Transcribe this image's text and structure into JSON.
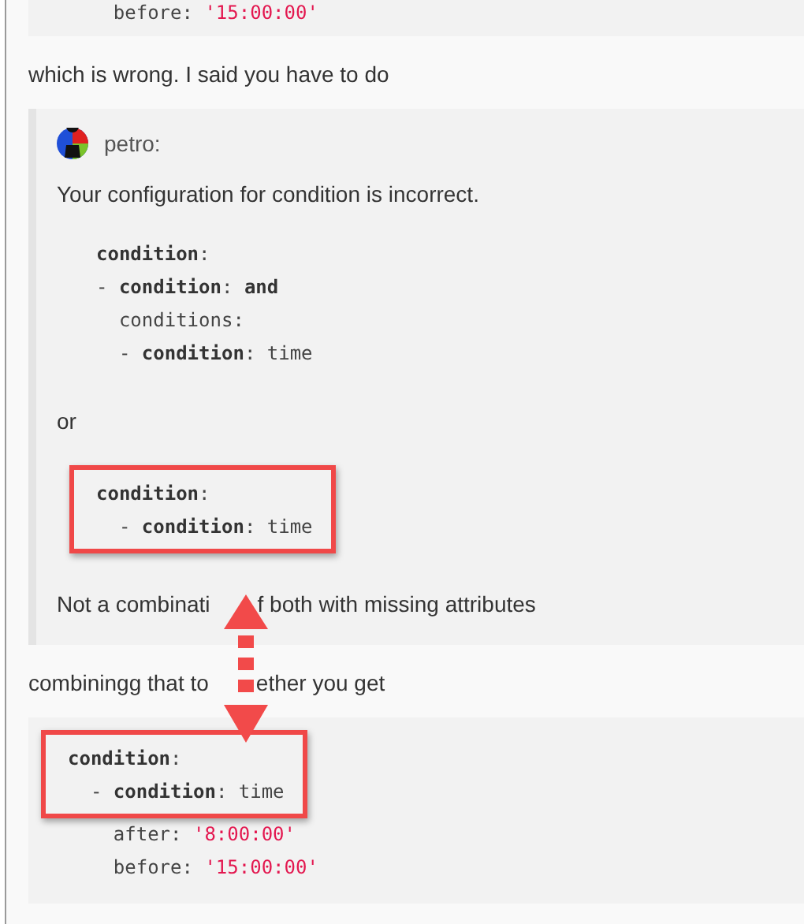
{
  "blocks": [
    {
      "kind": "code",
      "lines": [
        {
          "highlighted": false,
          "tokens": [
            {
              "kind": "plain",
              "text": "    before: "
            },
            {
              "kind": "string",
              "text": "'15:00:00'"
            }
          ]
        }
      ]
    },
    {
      "kind": "paragraph",
      "text": "which is wrong. I said you have to do"
    },
    {
      "kind": "quote",
      "author": "petro:",
      "blocks": [
        {
          "kind": "paragraph",
          "text": "Your configuration for condition is incorrect."
        },
        {
          "kind": "code",
          "lines": [
            {
              "highlighted": false,
              "tokens": [
                {
                  "kind": "key",
                  "text": "condition"
                },
                {
                  "kind": "plain",
                  "text": ":"
                }
              ]
            },
            {
              "highlighted": false,
              "tokens": [
                {
                  "kind": "plain",
                  "text": "- "
                },
                {
                  "kind": "key",
                  "text": "condition"
                },
                {
                  "kind": "plain",
                  "text": ": "
                },
                {
                  "kind": "key",
                  "text": "and"
                }
              ]
            },
            {
              "highlighted": false,
              "tokens": [
                {
                  "kind": "plain",
                  "text": "  conditions:"
                }
              ]
            },
            {
              "highlighted": false,
              "tokens": [
                {
                  "kind": "plain",
                  "text": "  - "
                },
                {
                  "kind": "key",
                  "text": "condition"
                },
                {
                  "kind": "plain",
                  "text": ": time"
                }
              ]
            }
          ]
        },
        {
          "kind": "paragraph",
          "text": "or"
        },
        {
          "kind": "code",
          "lines": [
            {
              "highlighted": true,
              "tokens": [
                {
                  "kind": "key",
                  "text": "condition"
                },
                {
                  "kind": "plain",
                  "text": ":"
                }
              ]
            },
            {
              "highlighted": true,
              "tokens": [
                {
                  "kind": "plain",
                  "text": "  - "
                },
                {
                  "kind": "key",
                  "text": "condition"
                },
                {
                  "kind": "plain",
                  "text": ": time"
                }
              ]
            }
          ]
        },
        {
          "kind": "paragraph",
          "parts": [
            "Not a combinati",
            "f both with missing attributes"
          ]
        }
      ]
    },
    {
      "kind": "paragraph",
      "parts": [
        "combiningg that to",
        "ether you get"
      ]
    },
    {
      "kind": "code",
      "lines": [
        {
          "highlighted": true,
          "tokens": [
            {
              "kind": "key",
              "text": "condition"
            },
            {
              "kind": "plain",
              "text": ":"
            }
          ]
        },
        {
          "highlighted": true,
          "tokens": [
            {
              "kind": "plain",
              "text": "  - "
            },
            {
              "kind": "key",
              "text": "condition"
            },
            {
              "kind": "plain",
              "text": ": time"
            }
          ]
        },
        {
          "highlighted": false,
          "tokens": [
            {
              "kind": "plain",
              "text": "    after: "
            },
            {
              "kind": "string",
              "text": "'8:00:00'"
            }
          ]
        },
        {
          "highlighted": false,
          "tokens": [
            {
              "kind": "plain",
              "text": "    before: "
            },
            {
              "kind": "string",
              "text": "'15:00:00'"
            }
          ]
        }
      ]
    }
  ]
}
